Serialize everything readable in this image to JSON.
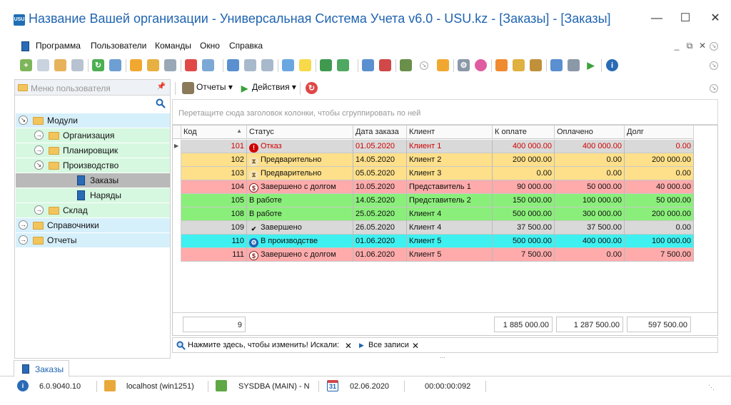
{
  "window": {
    "title": "Название Вашей организации - Универсальная Система Учета v6.0 - USU.kz - [Заказы] - [Заказы]",
    "logo_text": "USU"
  },
  "menu": {
    "items": [
      "Программа",
      "Пользователи",
      "Команды",
      "Окно",
      "Справка"
    ]
  },
  "left_panel": {
    "title": "Меню пользователя",
    "tree": [
      {
        "label": "Модули",
        "level": 0,
        "type": "folder",
        "expanded": true
      },
      {
        "label": "Организация",
        "level": 1,
        "type": "folder",
        "expanded": false
      },
      {
        "label": "Планировщик",
        "level": 1,
        "type": "folder",
        "expanded": false
      },
      {
        "label": "Производство",
        "level": 1,
        "type": "folder",
        "expanded": true
      },
      {
        "label": "Заказы",
        "level": 2,
        "type": "doc",
        "selected": true
      },
      {
        "label": "Наряды",
        "level": 2,
        "type": "doc"
      },
      {
        "label": "Склад",
        "level": 1,
        "type": "folder",
        "expanded": false
      },
      {
        "label": "Справочники",
        "level": 0,
        "type": "folder"
      },
      {
        "label": "Отчеты",
        "level": 0,
        "type": "folder"
      }
    ]
  },
  "right_toolbar": {
    "reports_label": "Отчеты",
    "actions_label": "Действия"
  },
  "group_panel": {
    "hint": "Перетащите сюда заголовок колонки, чтобы сгруппировать по ней"
  },
  "grid": {
    "columns": [
      "Код",
      "Статус",
      "Дата заказа",
      "Клиент",
      "К оплате",
      "Оплачено",
      "Долг"
    ],
    "rows": [
      {
        "code": "101",
        "status": "Отказ",
        "status_icon": "alert-icon",
        "date": "01.05.2020",
        "client": "Клиент 1",
        "to_pay": "400 000.00",
        "paid": "400 000.00",
        "debt": "0.00",
        "bg": "#d9d9d9",
        "fg": "#d10000"
      },
      {
        "code": "102",
        "status": "Предварительно",
        "status_icon": "hourglass-icon",
        "date": "14.05.2020",
        "client": "Клиент 2",
        "to_pay": "200 000.00",
        "paid": "0.00",
        "debt": "200 000.00",
        "bg": "#ffe08a",
        "fg": "#111111"
      },
      {
        "code": "103",
        "status": "Предварительно",
        "status_icon": "hourglass-icon",
        "date": "05.05.2020",
        "client": "Клиент 3",
        "to_pay": "0.00",
        "paid": "0.00",
        "debt": "0.00",
        "bg": "#ffe08a",
        "fg": "#111111"
      },
      {
        "code": "104",
        "status": "Завершено с долгом",
        "status_icon": "dollar-icon",
        "date": "10.05.2020",
        "client": "Представитель 1",
        "to_pay": "90 000.00",
        "paid": "50 000.00",
        "debt": "40 000.00",
        "bg": "#ffabab",
        "fg": "#111111"
      },
      {
        "code": "105",
        "status": "В работе",
        "status_icon": "",
        "date": "14.05.2020",
        "client": "Представитель 2",
        "to_pay": "150 000.00",
        "paid": "100 000.00",
        "debt": "50 000.00",
        "bg": "#8aef7a",
        "fg": "#111111"
      },
      {
        "code": "108",
        "status": "В работе",
        "status_icon": "",
        "date": "25.05.2020",
        "client": "Клиент 4",
        "to_pay": "500 000.00",
        "paid": "300 000.00",
        "debt": "200 000.00",
        "bg": "#8aef7a",
        "fg": "#111111"
      },
      {
        "code": "109",
        "status": "Завершено",
        "status_icon": "check-icon",
        "date": "26.05.2020",
        "client": "Клиент 4",
        "to_pay": "37 500.00",
        "paid": "37 500.00",
        "debt": "0.00",
        "bg": "#d9d9d9",
        "fg": "#111111"
      },
      {
        "code": "110",
        "status": "В производстве",
        "status_icon": "gear-icon",
        "date": "01.06.2020",
        "client": "Клиент 5",
        "to_pay": "500 000.00",
        "paid": "400 000.00",
        "debt": "100 000.00",
        "bg": "#3ff0f0",
        "fg": "#111111"
      },
      {
        "code": "111",
        "status": "Завершено с долгом",
        "status_icon": "dollar-icon",
        "date": "01.06.2020",
        "client": "Клиент 5",
        "to_pay": "7 500.00",
        "paid": "0.00",
        "debt": "7 500.00",
        "bg": "#ffabab",
        "fg": "#111111"
      }
    ],
    "totals": {
      "count": "9",
      "to_pay": "1 885 000.00",
      "paid": "1 287 500.00",
      "debt": "597 500.00"
    }
  },
  "filter_bar": {
    "hint": "Нажмите здесь, чтобы изменить! Искали:",
    "all_records": "Все записи"
  },
  "tabs": [
    {
      "label": "Заказы",
      "active": true
    }
  ],
  "status_bar": {
    "version": "6.0.9040.10",
    "server": "localhost (win1251)",
    "user": "SYSDBA (MAIN) - N",
    "date": "02.06.2020",
    "timer": "00:00:00:092",
    "calendar_day": "31"
  },
  "colors": {
    "accent": "#1f64b0",
    "selected_tree": "#b9b9b9",
    "tree_row_bg": "#d6f0fb",
    "tree_subrow_bg": "#d6f7e0"
  }
}
